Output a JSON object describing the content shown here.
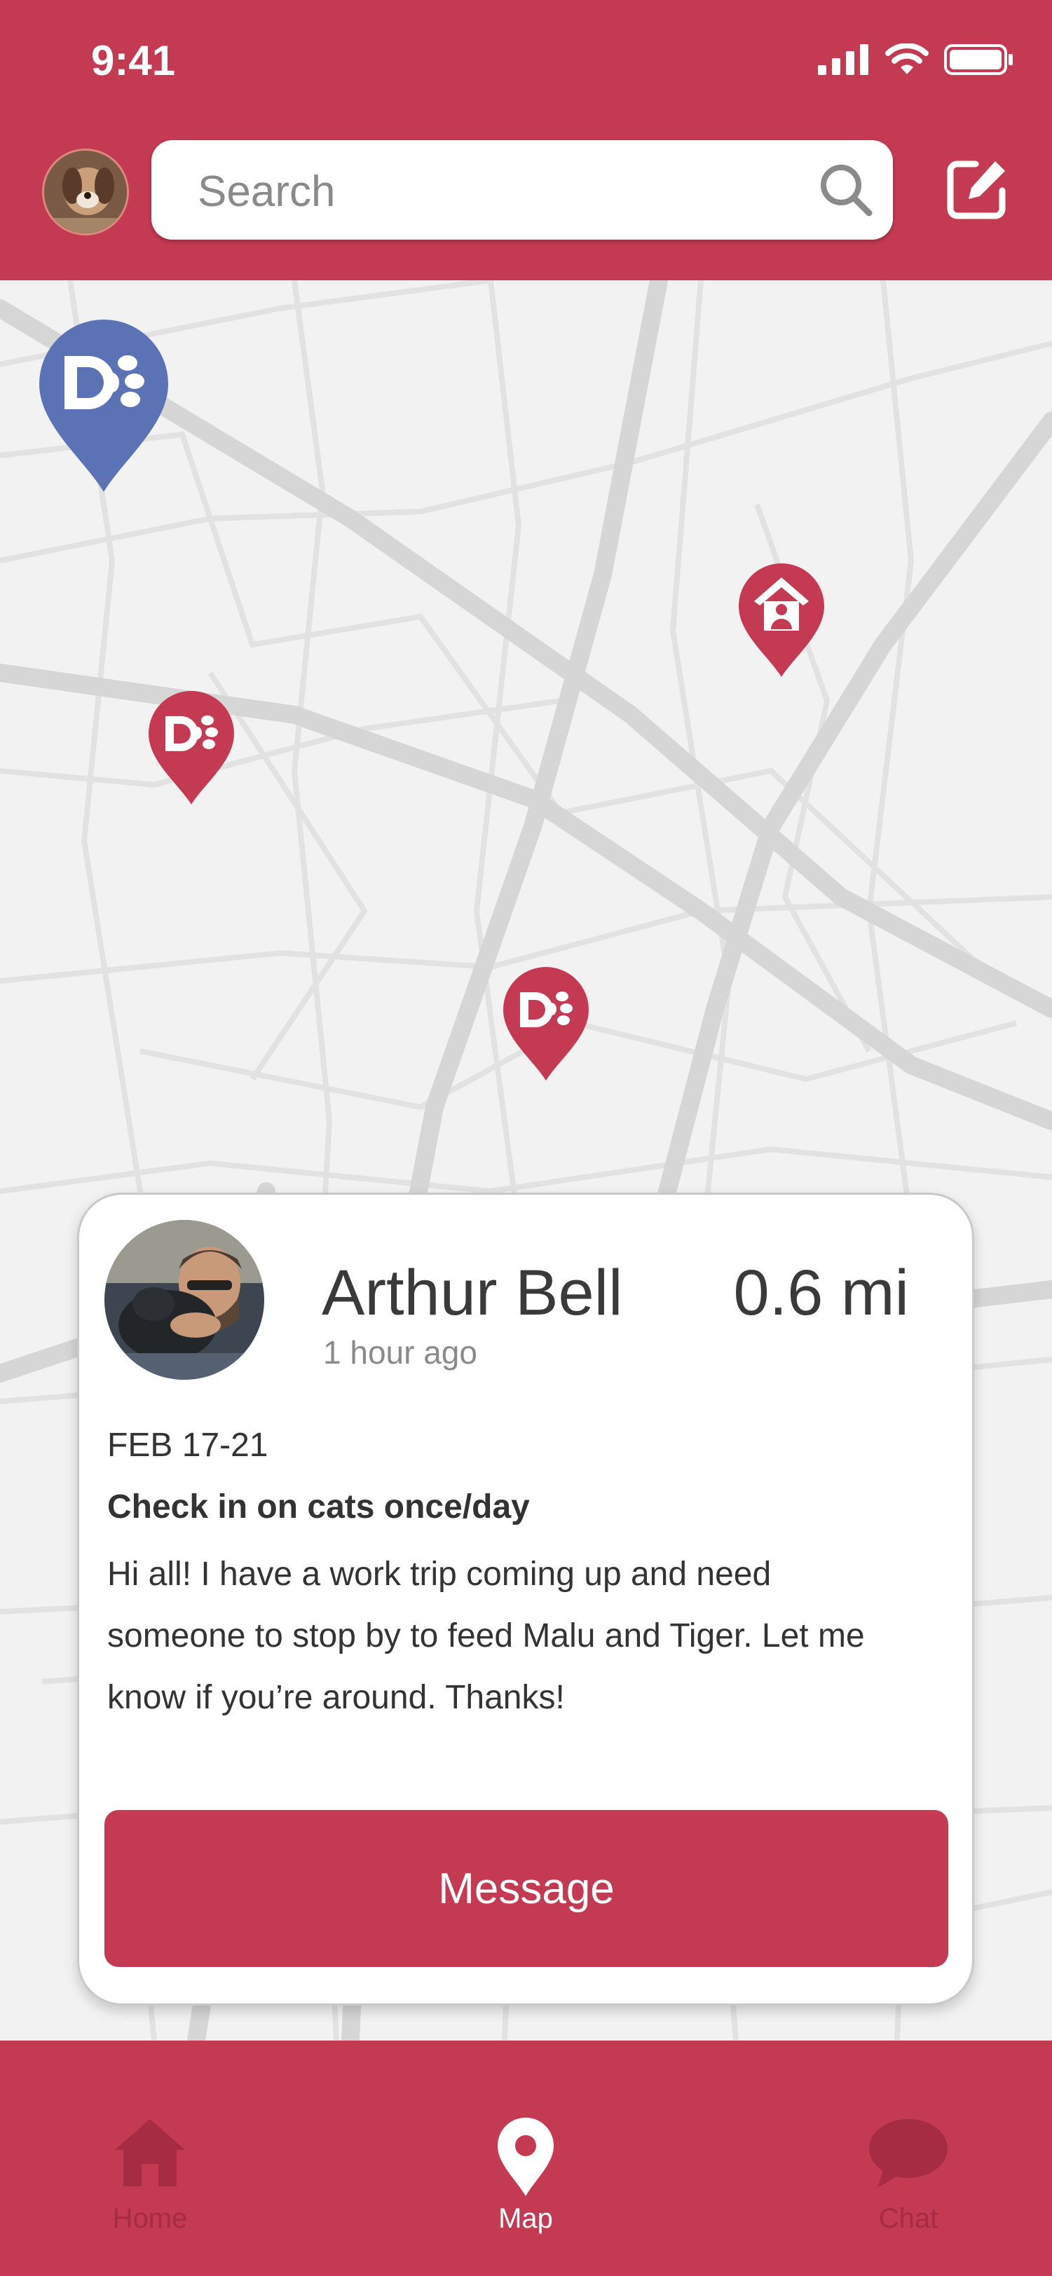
{
  "status_bar": {
    "time": "9:41"
  },
  "header": {
    "search_placeholder": "Search"
  },
  "map": {
    "pins": [
      {
        "type": "sitter",
        "color": "#5b73b4",
        "icon": "paw-logo-icon"
      },
      {
        "type": "home",
        "color": "#c43a52",
        "icon": "home-person-icon"
      },
      {
        "type": "sitter",
        "color": "#c43a52",
        "icon": "paw-logo-icon"
      },
      {
        "type": "sitter",
        "color": "#c43a52",
        "icon": "paw-logo-icon"
      }
    ]
  },
  "card": {
    "name": "Arthur Bell",
    "time_ago": "1 hour ago",
    "distance": "0.6 mi",
    "date_range": "FEB 17-21",
    "subject": "Check in on cats once/day",
    "body": "Hi all! I have a work trip coming up and need someone to stop by to feed Malu and Tiger. Let me know if you’re around. Thanks!",
    "button_label": "Message"
  },
  "tabbar": {
    "tabs": [
      {
        "label": "Home",
        "icon": "home-icon",
        "active": false
      },
      {
        "label": "Map",
        "icon": "map-pin-icon",
        "active": true
      },
      {
        "label": "Chat",
        "icon": "chat-bubble-icon",
        "active": false
      }
    ]
  },
  "colors": {
    "brand": "#c43a52",
    "brand_dark": "#a52c42",
    "pin_blue": "#5b73b4",
    "map_bg": "#f2f2f2",
    "road": "#d6d6d6"
  }
}
